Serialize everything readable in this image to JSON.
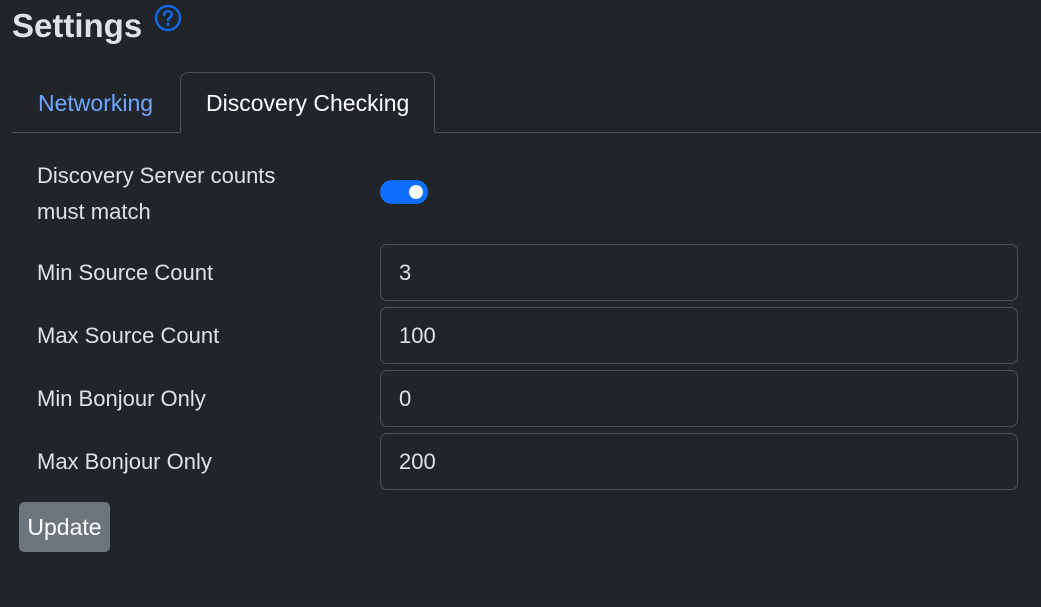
{
  "header": {
    "title": "Settings",
    "help_icon": "question-circle-icon"
  },
  "tabs": [
    {
      "label": "Networking",
      "active": false
    },
    {
      "label": "Discovery Checking",
      "active": true
    }
  ],
  "form": {
    "discovery_match": {
      "label": "Discovery Server counts must match",
      "enabled": true
    },
    "fields": [
      {
        "label": "Min Source Count",
        "value": "3"
      },
      {
        "label": "Max Source Count",
        "value": "100"
      },
      {
        "label": "Min Bonjour Only",
        "value": "0"
      },
      {
        "label": "Max Bonjour Only",
        "value": "200"
      }
    ],
    "submit_label": "Update"
  },
  "colors": {
    "background": "#212529",
    "accent": "#0d6efd",
    "link": "#6ea8fe",
    "button": "#6c757d"
  }
}
